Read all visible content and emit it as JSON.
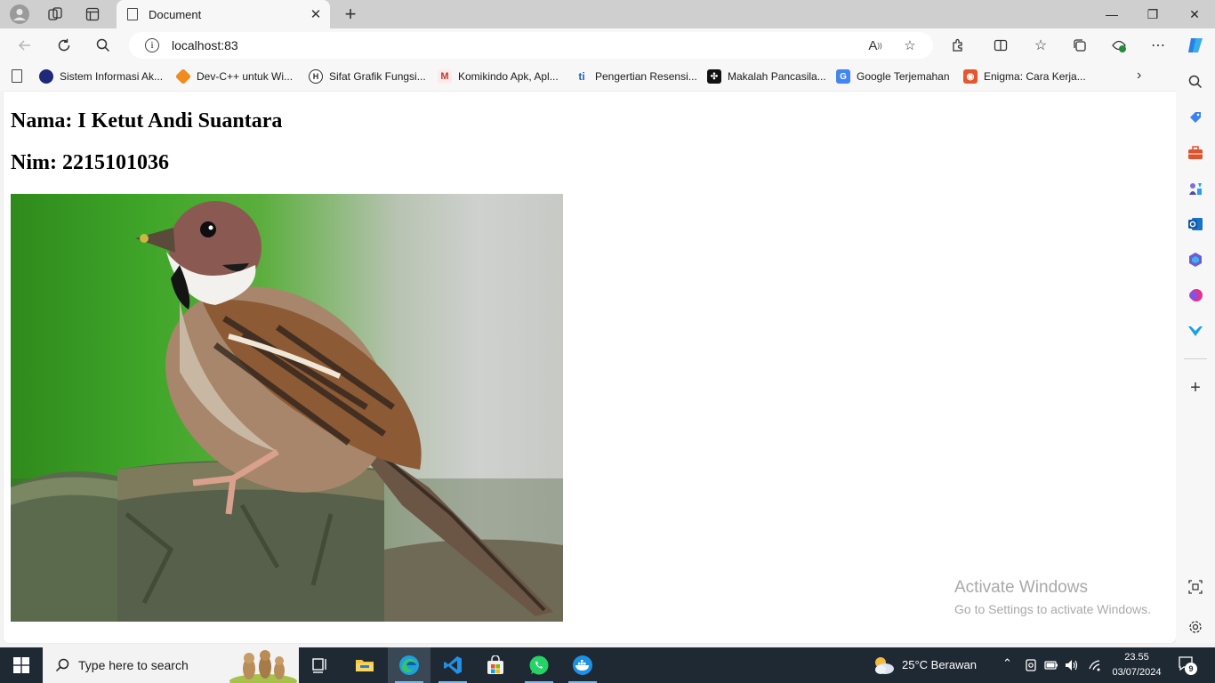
{
  "browser": {
    "tab_title": "Document",
    "tab_close": "✕",
    "new_tab": "+",
    "url": "localhost:83",
    "window_controls": {
      "minimize": "—",
      "maximize": "❐",
      "close": "✕"
    }
  },
  "bookmarks": [
    {
      "label": "Sistem Informasi Ak...",
      "icon": "university-logo-icon",
      "color": "#1e2a78"
    },
    {
      "label": "Dev-C++ untuk Wi...",
      "icon": "dev-cpp-icon",
      "color": "#f08c1d"
    },
    {
      "label": "Sifat Grafik Fungsi...",
      "icon": "h-site-icon",
      "color": "#2b2b2b"
    },
    {
      "label": "Komikindo Apk, Apl...",
      "icon": "m-site-icon",
      "color": "#c0392b"
    },
    {
      "label": "Pengertian Resensi...",
      "icon": "ti-site-icon",
      "color": "#1e63c6"
    },
    {
      "label": "Makalah Pancasila...",
      "icon": "black-site-icon",
      "color": "#111111"
    },
    {
      "label": "Google Terjemahan",
      "icon": "google-translate-icon",
      "color": "#4285f4"
    },
    {
      "label": "Enigma: Cara Kerja...",
      "icon": "enigma-site-icon",
      "color": "#e4572e"
    }
  ],
  "page": {
    "nama": "Nama: I Ketut Andi Suantara",
    "nim": "Nim: 2215101036"
  },
  "watermark": {
    "title": "Activate Windows",
    "subtitle": "Go to Settings to activate Windows."
  },
  "taskbar": {
    "search_placeholder": "Type here to search",
    "weather": "25°C  Berawan",
    "time": "23.55",
    "date": "03/07/2024",
    "notification_count": "9"
  },
  "colors": {
    "taskbar": "#1f2933",
    "content_bg": "#ffffff",
    "chrome_bg": "#f7f7f7",
    "titlebar_bg": "#cfcfcf"
  }
}
